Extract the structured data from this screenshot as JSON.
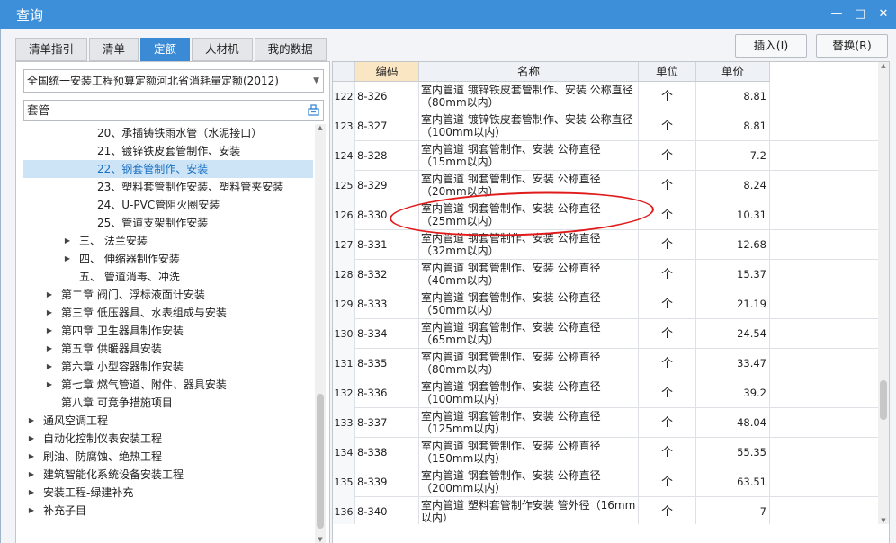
{
  "window": {
    "title": "查询"
  },
  "tabs": [
    {
      "label": "清单指引",
      "active": false
    },
    {
      "label": "清单",
      "active": false
    },
    {
      "label": "定额",
      "active": true
    },
    {
      "label": "人材机",
      "active": false
    },
    {
      "label": "我的数据",
      "active": false
    }
  ],
  "actions": {
    "insert_label": "插入(I)",
    "replace_label": "替换(R)"
  },
  "left_panel": {
    "library_select": "全国统一安装工程预算定额河北省消耗量定额(2012)",
    "search_value": "套管",
    "tree": [
      {
        "label": "20、承插铸铁雨水管（水泥接口）",
        "toggle": "",
        "selected": false
      },
      {
        "label": "21、镀锌铁皮套管制作、安装",
        "toggle": "",
        "selected": false
      },
      {
        "label": "22、钢套管制作、安装",
        "toggle": "",
        "selected": true
      },
      {
        "label": "23、塑料套管制作安装、塑料管夹安装",
        "toggle": "",
        "selected": false
      },
      {
        "label": "24、U-PVC管阻火圈安装",
        "toggle": "",
        "selected": false
      },
      {
        "label": "25、管道支架制作安装",
        "toggle": "",
        "selected": false
      },
      {
        "label": "三、 法兰安装",
        "toggle": "▶",
        "selected": false
      },
      {
        "label": "四、 伸缩器制作安装",
        "toggle": "▶",
        "selected": false
      },
      {
        "label": "五、 管道消毒、冲洗",
        "toggle": "",
        "selected": false
      },
      {
        "label": "第二章 阀门、浮标液面计安装",
        "toggle": "▶",
        "selected": false
      },
      {
        "label": "第三章 低压器具、水表组成与安装",
        "toggle": "▶",
        "selected": false
      },
      {
        "label": "第四章 卫生器具制作安装",
        "toggle": "▶",
        "selected": false
      },
      {
        "label": "第五章 供暖器具安装",
        "toggle": "▶",
        "selected": false
      },
      {
        "label": "第六章 小型容器制作安装",
        "toggle": "▶",
        "selected": false
      },
      {
        "label": "第七章 燃气管道、附件、器具安装",
        "toggle": "▶",
        "selected": false
      },
      {
        "label": "第八章 可竞争措施项目",
        "toggle": "",
        "selected": false
      },
      {
        "label": "通风空调工程",
        "toggle": "▶",
        "selected": false
      },
      {
        "label": "自动化控制仪表安装工程",
        "toggle": "▶",
        "selected": false
      },
      {
        "label": "刷油、防腐蚀、绝热工程",
        "toggle": "▶",
        "selected": false
      },
      {
        "label": "建筑智能化系统设备安装工程",
        "toggle": "▶",
        "selected": false
      },
      {
        "label": "安装工程-绿建补充",
        "toggle": "▶",
        "selected": false
      },
      {
        "label": "补充子目",
        "toggle": "▶",
        "selected": false
      }
    ]
  },
  "table": {
    "headers": {
      "code": "编码",
      "name": "名称",
      "unit": "单位",
      "price": "单价"
    },
    "rows": [
      {
        "idx": "122",
        "code": "8-326",
        "name": "室内管道 镀锌铁皮套管制作、安装 公称直径（80mm以内）",
        "unit": "个",
        "price": "8.81"
      },
      {
        "idx": "123",
        "code": "8-327",
        "name": "室内管道 镀锌铁皮套管制作、安装 公称直径（100mm以内）",
        "unit": "个",
        "price": "8.81"
      },
      {
        "idx": "124",
        "code": "8-328",
        "name": "室内管道 钢套管制作、安装 公称直径（15mm以内）",
        "unit": "个",
        "price": "7.2"
      },
      {
        "idx": "125",
        "code": "8-329",
        "name": "室内管道 钢套管制作、安装 公称直径（20mm以内）",
        "unit": "个",
        "price": "8.24"
      },
      {
        "idx": "126",
        "code": "8-330",
        "name": "室内管道 钢套管制作、安装 公称直径（25mm以内）",
        "unit": "个",
        "price": "10.31"
      },
      {
        "idx": "127",
        "code": "8-331",
        "name": "室内管道 钢套管制作、安装 公称直径（32mm以内）",
        "unit": "个",
        "price": "12.68"
      },
      {
        "idx": "128",
        "code": "8-332",
        "name": "室内管道 钢套管制作、安装 公称直径（40mm以内）",
        "unit": "个",
        "price": "15.37"
      },
      {
        "idx": "129",
        "code": "8-333",
        "name": "室内管道 钢套管制作、安装 公称直径（50mm以内）",
        "unit": "个",
        "price": "21.19"
      },
      {
        "idx": "130",
        "code": "8-334",
        "name": "室内管道 钢套管制作、安装 公称直径（65mm以内）",
        "unit": "个",
        "price": "24.54"
      },
      {
        "idx": "131",
        "code": "8-335",
        "name": "室内管道 钢套管制作、安装 公称直径（80mm以内）",
        "unit": "个",
        "price": "33.47"
      },
      {
        "idx": "132",
        "code": "8-336",
        "name": "室内管道 钢套管制作、安装 公称直径（100mm以内）",
        "unit": "个",
        "price": "39.2"
      },
      {
        "idx": "133",
        "code": "8-337",
        "name": "室内管道 钢套管制作、安装 公称直径（125mm以内）",
        "unit": "个",
        "price": "48.04"
      },
      {
        "idx": "134",
        "code": "8-338",
        "name": "室内管道 钢套管制作、安装 公称直径（150mm以内）",
        "unit": "个",
        "price": "55.35"
      },
      {
        "idx": "135",
        "code": "8-339",
        "name": "室内管道 钢套管制作、安装 公称直径（200mm以内）",
        "unit": "个",
        "price": "63.51"
      },
      {
        "idx": "136",
        "code": "8-340",
        "name": "室内管道 塑料套管制作安装 管外径（16mm以内）",
        "unit": "个",
        "price": "7"
      }
    ]
  },
  "colors": {
    "accent": "#3b8ad6",
    "title_bar": "#3c8fd8",
    "sorted_header": "#fbe6c4",
    "annotation": "#e11b1b",
    "selection": "#cde4f7"
  },
  "icons": {
    "minimize": "minimize-icon",
    "maximize": "maximize-icon",
    "close": "close-icon",
    "search": "search-icon",
    "dropdown": "chevron-down-icon"
  }
}
